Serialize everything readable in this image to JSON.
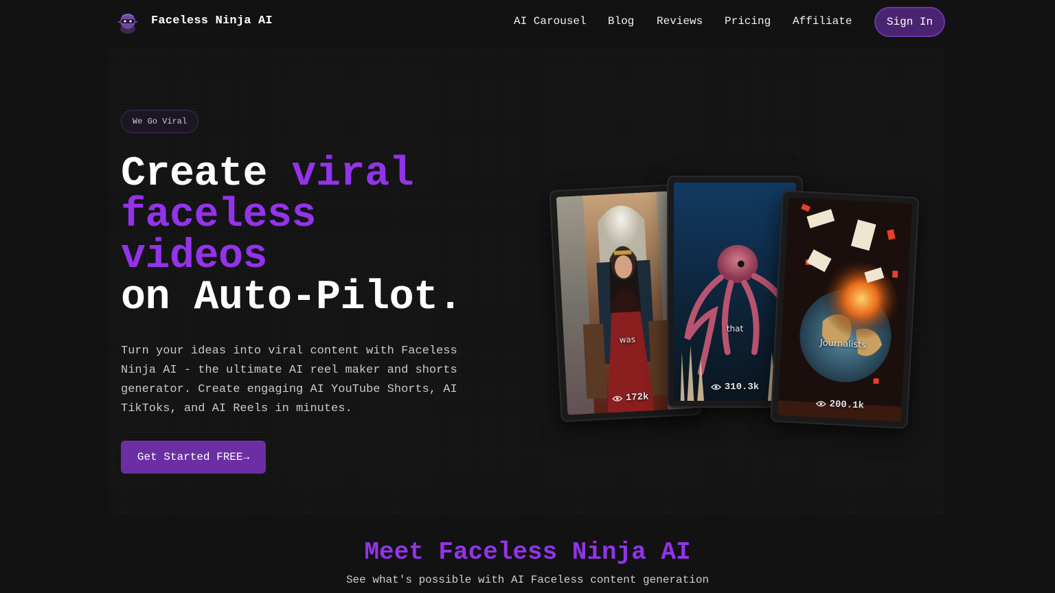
{
  "nav": {
    "brand": "Faceless Ninja AI",
    "links": [
      "AI Carousel",
      "Blog",
      "Reviews",
      "Pricing",
      "Affiliate"
    ],
    "signin_label": "Sign In"
  },
  "hero": {
    "badge": "We Go Viral",
    "headline_1": "Create ",
    "headline_accent_1": "viral",
    "headline_accent_2": "faceless",
    "headline_accent_3": "videos",
    "headline_2": "on Auto-Pilot.",
    "lead": "Turn your ideas into viral content with Faceless Ninja AI - the ultimate AI reel maker and shorts generator. Create engaging AI YouTube Shorts, AI TikToks, and AI Reels in minutes.",
    "cta_label": "Get Started FREE→"
  },
  "cards": [
    {
      "caption": "was",
      "views": "172k",
      "icon": "eye-icon"
    },
    {
      "caption": "that",
      "views": "310.3k",
      "icon": "eye-icon"
    },
    {
      "caption": "Journalists",
      "views": "200.1k",
      "icon": "eye-icon"
    }
  ],
  "section": {
    "title": "Meet Faceless Ninja AI",
    "subtitle": "See what's possible with AI Faceless content generation"
  },
  "colors": {
    "background": "#121212",
    "accent": "#9333ea",
    "button": "#6b2fa3"
  }
}
